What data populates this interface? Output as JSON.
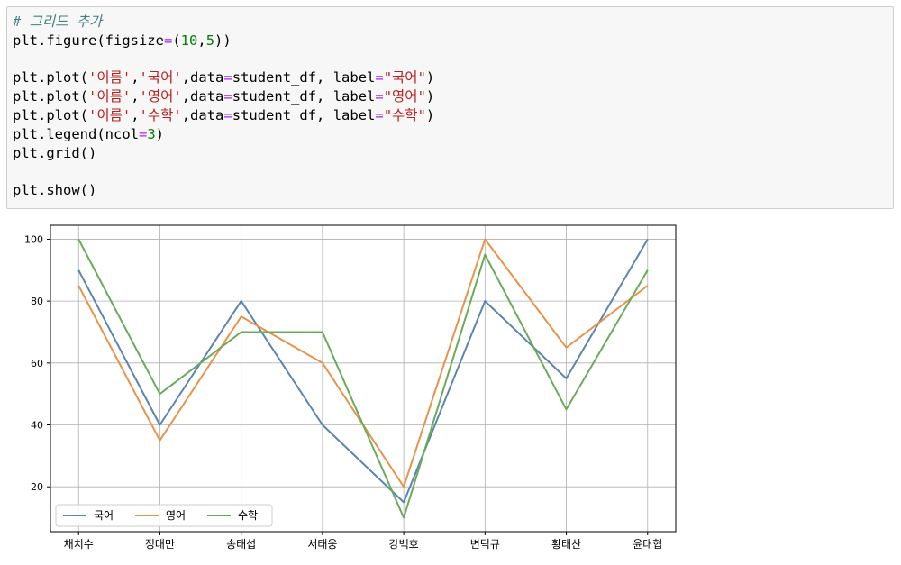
{
  "code_cell": {
    "lines": [
      [
        {
          "t": "# 그리드 추가",
          "c": "comment"
        }
      ],
      [
        {
          "t": "plt.figure(figsize",
          "c": "kw"
        },
        {
          "t": "=",
          "c": "op"
        },
        {
          "t": "(",
          "c": "kw"
        },
        {
          "t": "10",
          "c": "num"
        },
        {
          "t": ",",
          "c": "kw"
        },
        {
          "t": "5",
          "c": "num"
        },
        {
          "t": "))",
          "c": "kw"
        }
      ],
      [],
      [
        {
          "t": "plt.plot(",
          "c": "kw"
        },
        {
          "t": "'이름'",
          "c": "str"
        },
        {
          "t": ",",
          "c": "kw"
        },
        {
          "t": "'국어'",
          "c": "str"
        },
        {
          "t": ",data",
          "c": "kw"
        },
        {
          "t": "=",
          "c": "op"
        },
        {
          "t": "student_df, label",
          "c": "kw"
        },
        {
          "t": "=",
          "c": "op"
        },
        {
          "t": "\"국어\"",
          "c": "str"
        },
        {
          "t": ")",
          "c": "kw"
        }
      ],
      [
        {
          "t": "plt.plot(",
          "c": "kw"
        },
        {
          "t": "'이름'",
          "c": "str"
        },
        {
          "t": ",",
          "c": "kw"
        },
        {
          "t": "'영어'",
          "c": "str"
        },
        {
          "t": ",data",
          "c": "kw"
        },
        {
          "t": "=",
          "c": "op"
        },
        {
          "t": "student_df, label",
          "c": "kw"
        },
        {
          "t": "=",
          "c": "op"
        },
        {
          "t": "\"영어\"",
          "c": "str"
        },
        {
          "t": ")",
          "c": "kw"
        }
      ],
      [
        {
          "t": "plt.plot(",
          "c": "kw"
        },
        {
          "t": "'이름'",
          "c": "str"
        },
        {
          "t": ",",
          "c": "kw"
        },
        {
          "t": "'수학'",
          "c": "str"
        },
        {
          "t": ",data",
          "c": "kw"
        },
        {
          "t": "=",
          "c": "op"
        },
        {
          "t": "student_df, label",
          "c": "kw"
        },
        {
          "t": "=",
          "c": "op"
        },
        {
          "t": "\"수학\"",
          "c": "str"
        },
        {
          "t": ")",
          "c": "kw"
        }
      ],
      [
        {
          "t": "plt.legend(ncol",
          "c": "kw"
        },
        {
          "t": "=",
          "c": "op"
        },
        {
          "t": "3",
          "c": "num"
        },
        {
          "t": ")",
          "c": "kw"
        }
      ],
      [
        {
          "t": "plt.grid()",
          "c": "kw"
        }
      ],
      [],
      [
        {
          "t": "plt.show()",
          "c": "kw"
        }
      ]
    ]
  },
  "chart_data": {
    "type": "line",
    "categories": [
      "채치수",
      "정대만",
      "송태섭",
      "서태웅",
      "강백호",
      "변덕규",
      "황태산",
      "윤대협"
    ],
    "series": [
      {
        "name": "국어",
        "color": "#5b84b1",
        "values": [
          90,
          40,
          80,
          40,
          15,
          80,
          55,
          100
        ]
      },
      {
        "name": "영어",
        "color": "#e8934a",
        "values": [
          85,
          35,
          75,
          60,
          20,
          100,
          65,
          85
        ]
      },
      {
        "name": "수학",
        "color": "#6aab5a",
        "values": [
          100,
          50,
          70,
          70,
          10,
          95,
          45,
          90
        ]
      }
    ],
    "yticks": [
      20,
      40,
      60,
      80,
      100
    ],
    "ylim": [
      5.5,
      104.5
    ],
    "grid": true,
    "legend_loc": "lower-left",
    "legend_ncol": 3
  }
}
